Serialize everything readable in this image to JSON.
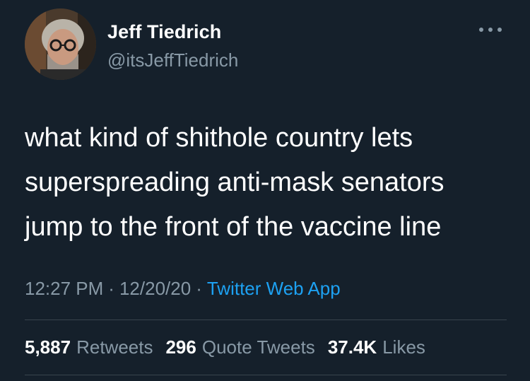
{
  "tweet": {
    "author": {
      "display_name": "Jeff Tiedrich",
      "handle": "@itsJeffTiedrich"
    },
    "text": "what kind of shithole country lets\nsuperspreading anti-mask senators\njump to the front of the vaccine line",
    "time": "12:27 PM",
    "separator": "·",
    "date": "12/20/20",
    "source": "Twitter Web App",
    "stats": {
      "retweets_count": "5,887",
      "retweets_label": "Retweets",
      "quote_count": "296",
      "quote_label": "Quote Tweets",
      "likes_count": "37.4K",
      "likes_label": "Likes"
    }
  },
  "icons": {
    "more": "more-horizontal-icon"
  },
  "colors": {
    "background": "#15202b",
    "primary_text": "#ffffff",
    "secondary_text": "#8899a6",
    "link": "#1da1f2",
    "divider": "#38444d"
  }
}
